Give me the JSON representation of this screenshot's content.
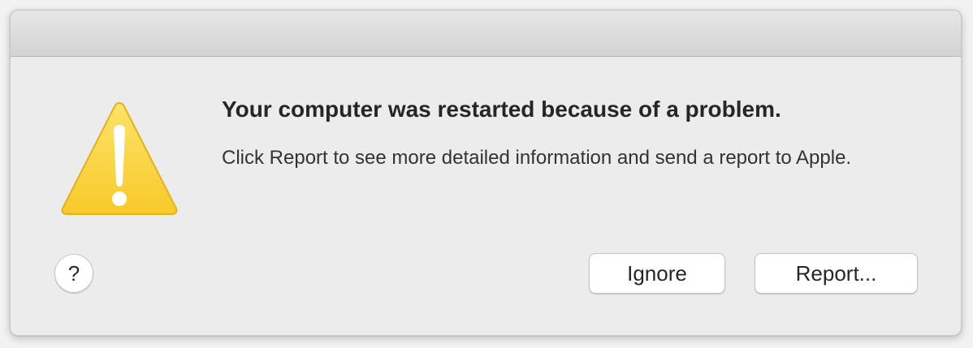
{
  "dialog": {
    "title": "Your computer was restarted because of a problem.",
    "message": "Click Report to see more detailed information and send a report to Apple.",
    "icon": "warning-triangle-icon",
    "help_label": "?",
    "buttons": {
      "ignore_label": "Ignore",
      "report_label": "Report..."
    }
  },
  "colors": {
    "warning_fill": "#fcd53a",
    "warning_edge": "#e3b21b",
    "dialog_bg": "#ececec"
  }
}
